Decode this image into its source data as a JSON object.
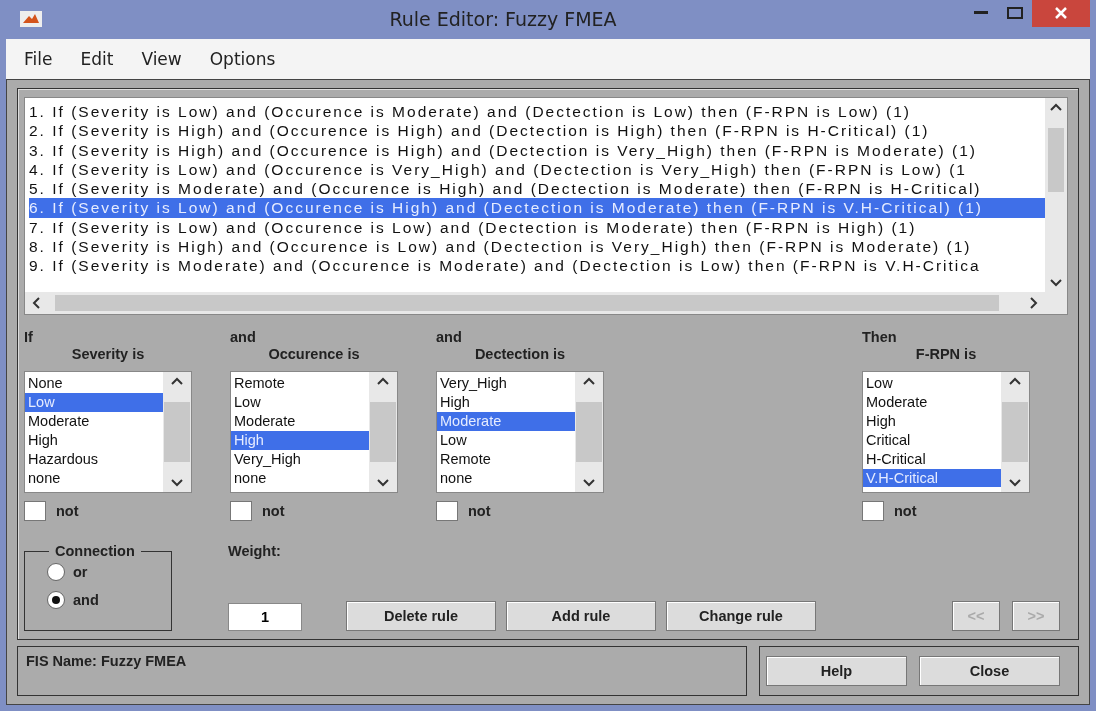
{
  "window": {
    "title": "Rule Editor: Fuzzy FMEA"
  },
  "menu": [
    "File",
    "Edit",
    "View",
    "Options"
  ],
  "rules": [
    {
      "text": "1. If (Severity is Low) and (Occurence is Moderate) and (Dectection is Low) then (F-RPN is Low) (1)",
      "selected": false
    },
    {
      "text": "2. If (Severity is High) and (Occurence is High) and (Dectection is High) then (F-RPN is H-Critical) (1)",
      "selected": false
    },
    {
      "text": "3. If (Severity is High) and (Occurence is High) and (Dectection is Very_High) then (F-RPN is Moderate) (1)",
      "selected": false
    },
    {
      "text": "4. If (Severity is Low) and (Occurence is Very_High) and (Dectection is Very_High) then (F-RPN is Low) (1",
      "selected": false
    },
    {
      "text": "5. If (Severity is Moderate) and (Occurence is High) and (Dectection is Moderate) then (F-RPN is H-Critical)",
      "selected": false
    },
    {
      "text": "6. If (Severity is Low) and (Occurence is High) and (Dectection is Moderate) then (F-RPN is V.H-Critical) (1)",
      "selected": true
    },
    {
      "text": "7. If (Severity is Low) and (Occurence is Low) and (Dectection is Moderate) then (F-RPN is High) (1)",
      "selected": false
    },
    {
      "text": "8. If (Severity is High) and (Occurence is Low) and (Dectection is Very_High) then (F-RPN is Moderate) (1)",
      "selected": false
    },
    {
      "text": "9. If (Severity is Moderate) and (Occurence is Moderate) and (Dectection is Low) then (F-RPN is V.H-Critica",
      "selected": false
    }
  ],
  "selectors": [
    {
      "prefix": "If",
      "label": "Severity is",
      "not_checked": false,
      "not_label": "not",
      "options": [
        {
          "label": "None",
          "selected": false
        },
        {
          "label": "Low",
          "selected": true
        },
        {
          "label": "Moderate",
          "selected": false
        },
        {
          "label": "High",
          "selected": false
        },
        {
          "label": "Hazardous",
          "selected": false
        },
        {
          "label": "none",
          "selected": false
        }
      ]
    },
    {
      "prefix": "and",
      "label": "Occurence is",
      "not_checked": false,
      "not_label": "not",
      "options": [
        {
          "label": "Remote",
          "selected": false
        },
        {
          "label": "Low",
          "selected": false
        },
        {
          "label": "Moderate",
          "selected": false
        },
        {
          "label": "High",
          "selected": true
        },
        {
          "label": "Very_High",
          "selected": false
        },
        {
          "label": "none",
          "selected": false
        }
      ]
    },
    {
      "prefix": "and",
      "label": "Dectection is",
      "not_checked": false,
      "not_label": "not",
      "options": [
        {
          "label": "Very_High",
          "selected": false
        },
        {
          "label": "High",
          "selected": false
        },
        {
          "label": "Moderate",
          "selected": true
        },
        {
          "label": "Low",
          "selected": false
        },
        {
          "label": "Remote",
          "selected": false
        },
        {
          "label": "none",
          "selected": false
        }
      ]
    },
    {
      "prefix": "Then",
      "label": "F-RPN is",
      "not_checked": false,
      "not_label": "not",
      "options": [
        {
          "label": "Low",
          "selected": false
        },
        {
          "label": "Moderate",
          "selected": false
        },
        {
          "label": "High",
          "selected": false
        },
        {
          "label": "Critical",
          "selected": false
        },
        {
          "label": "H-Critical",
          "selected": false
        },
        {
          "label": "V.H-Critical",
          "selected": true
        }
      ]
    }
  ],
  "connection": {
    "label": "Connection",
    "options": [
      {
        "label": "or",
        "selected": false
      },
      {
        "label": "and",
        "selected": true
      }
    ]
  },
  "weight": {
    "label": "Weight:",
    "value": "1"
  },
  "buttons": [
    {
      "label": "Delete rule",
      "disabled": false
    },
    {
      "label": "Add rule",
      "disabled": false
    },
    {
      "label": "Change rule",
      "disabled": false
    }
  ],
  "nav_buttons": [
    {
      "label": "<<",
      "disabled": true
    },
    {
      "label": ">>",
      "disabled": true
    }
  ],
  "status": "FIS Name: Fuzzy FMEA",
  "footer_buttons": [
    {
      "label": "Help"
    },
    {
      "label": "Close"
    }
  ]
}
